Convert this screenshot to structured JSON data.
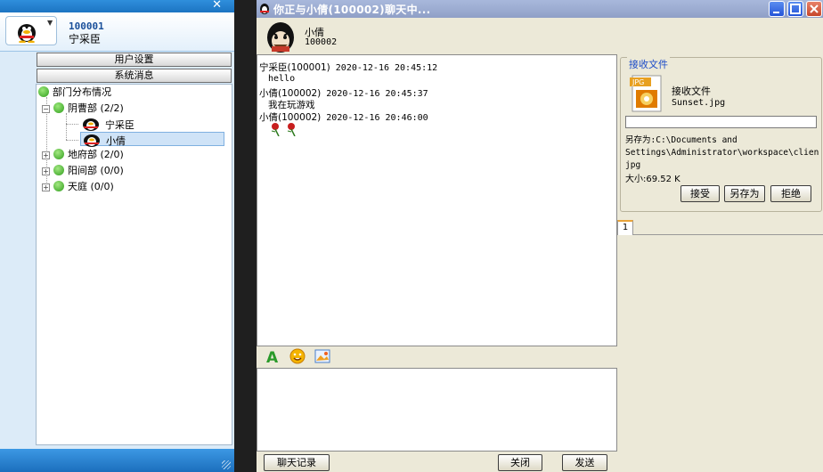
{
  "left_window": {
    "close_glyph": "✕",
    "user": {
      "id": "100001",
      "name": "宁采臣"
    },
    "buttons": {
      "user_settings": "用户设置",
      "system_messages": "系统消息"
    },
    "tree": {
      "root": "部门分布情况",
      "groups": [
        {
          "label": "阴曹部 (2/2)",
          "expanded": true,
          "members": [
            "宁采臣",
            "小倩"
          ]
        },
        {
          "label": "地府部 (2/0)",
          "expanded": false
        },
        {
          "label": "阳间部 (0/0)",
          "expanded": false
        },
        {
          "label": "天庭 (0/0)",
          "expanded": false
        }
      ]
    }
  },
  "chat_window": {
    "title": "你正与小倩(100002)聊天中...",
    "friend": {
      "name": "小倩",
      "id": "100002"
    },
    "messages": [
      {
        "sender": "宁采臣(100001)",
        "time": "2020-12-16 20:45:12",
        "text": "hello"
      },
      {
        "sender": "小倩(100002)",
        "time": "2020-12-16 20:45:37",
        "text": "我在玩游戏"
      },
      {
        "sender": "小倩(100002)",
        "time": "2020-12-16 20:46:00",
        "text": ""
      }
    ],
    "buttons": {
      "history": "聊天记录",
      "close": "关闭",
      "send": "发送"
    },
    "file_panel": {
      "legend": "接收文件",
      "heading": "接收文件",
      "icon_label": "JPG",
      "filename": "Sunset.jpg",
      "save_path": "另存为:C:\\Documents and Settings\\Administrator\\workspace\\client\\jpg",
      "save_path_line1": "另存为:C:\\Documents and",
      "save_path_line2": "Settings\\Administrator\\workspace\\clien",
      "save_path_line3": "jpg",
      "size": "大小:69.52 K",
      "accept": "接受",
      "save_as": "另存为",
      "reject": "拒绝"
    },
    "tab_label": "1"
  },
  "colors": {
    "accent_blue": "#1c74c2",
    "title_bar": "#9aaad0",
    "window_bg": "#ece9d8",
    "tree_green": "#2f9e1c"
  }
}
